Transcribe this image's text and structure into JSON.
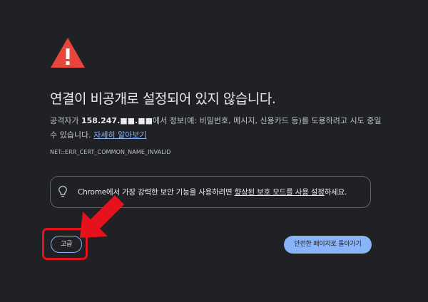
{
  "error_page": {
    "title": "연결이 비공개로 설정되어 있지 않습니다.",
    "description_prefix": "공격자가 ",
    "ip_address": "158.247.■■.■■",
    "description_suffix": "에서 정보(예: 비밀번호, 메시지, 신용카드 등)를 도용하려고 시도 중일 수 있습니다. ",
    "learn_more_link": "자세히 알아보기",
    "error_code": "NET::ERR_CERT_COMMON_NAME_INVALID"
  },
  "tip": {
    "text_before": "Chrome에서 가장 강력한 보안 기능을 사용하려면 ",
    "link": "향상된 보호 모드를 사용 설정",
    "text_after": "하세요."
  },
  "buttons": {
    "advanced": "고급",
    "back_to_safety": "안전한 페이지로 돌아가기"
  },
  "colors": {
    "background": "#202124",
    "warning_red": "#e8453c",
    "link_blue": "#8ab4f8",
    "annotation_red": "#e6121b"
  },
  "icons": {
    "warning": "warning-triangle-icon",
    "tip": "lightbulb-icon",
    "annotation": "red-arrow-icon"
  }
}
